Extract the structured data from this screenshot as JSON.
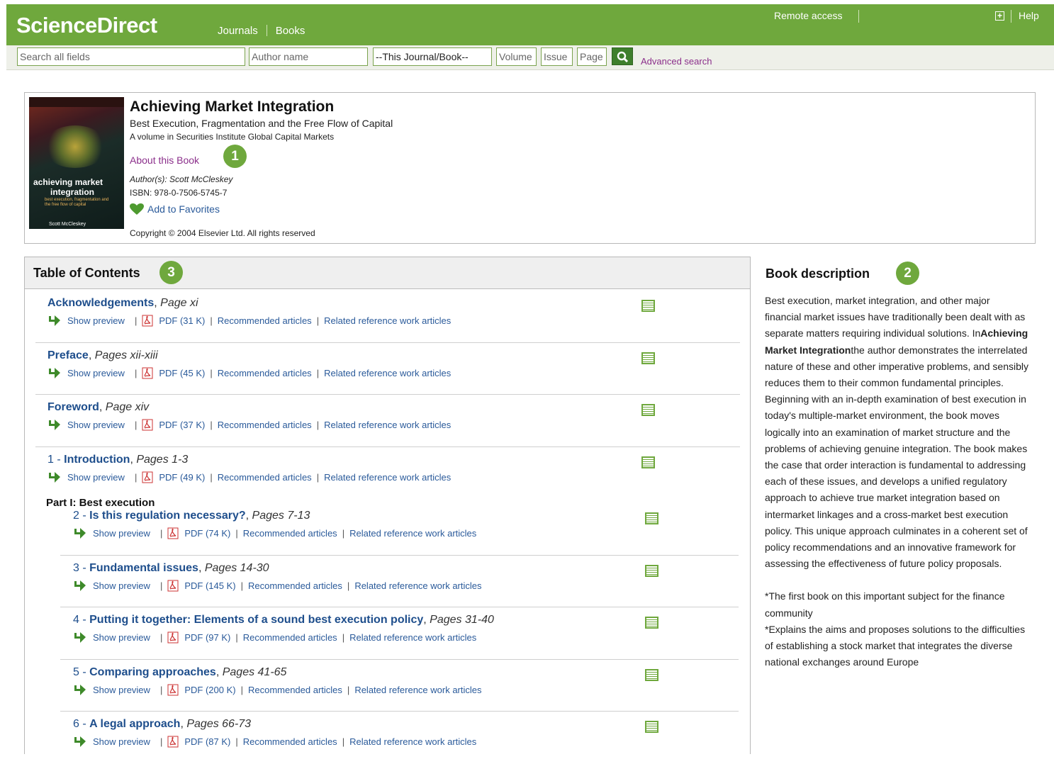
{
  "header": {
    "logo": "ScienceDirect",
    "nav": [
      "Journals",
      "Books"
    ],
    "remote_access": "Remote access",
    "help": "Help",
    "brand_color": "#6fa83d"
  },
  "search": {
    "all_fields_placeholder": "Search all fields",
    "author_placeholder": "Author name",
    "journal_select_value": "--This Journal/Book--",
    "volume_placeholder": "Volume",
    "issue_placeholder": "Issue",
    "page_placeholder": "Page",
    "advanced_label": "Advanced search"
  },
  "book": {
    "title": "Achieving Market Integration",
    "subtitle": "Best Execution, Fragmentation and the Free Flow of Capital",
    "volume": "A volume in Securities Institute Global Capital Markets",
    "about_link": "About this Book",
    "authors": "Author(s): Scott McCleskey",
    "isbn": "ISBN: 978-0-7506-5745-7",
    "favorites_label": "Add to Favorites",
    "copyright": "Copyright © 2004 Elsevier Ltd. All rights reserved",
    "cover": {
      "title_line1": "achieving market",
      "title_line2": "integration",
      "subtitle": "best execution, fragmentation and the free flow of capital",
      "author": "Scott McCleskey"
    }
  },
  "badges": [
    "1",
    "2",
    "3"
  ],
  "toc": {
    "heading": "Table of Contents",
    "part_label": "Part I: Best execution",
    "entries": [
      {
        "title": "Acknowledgements",
        "pages": "Page xi",
        "pdf": "PDF (31 K)"
      },
      {
        "title": "Preface",
        "pages": "Pages xii-xiii",
        "pdf": "PDF (45 K)"
      },
      {
        "title": "Foreword",
        "pages": "Page xiv",
        "pdf": "PDF (37 K)"
      },
      {
        "num": "1 - ",
        "title": "Introduction",
        "pages": "Pages 1-3",
        "pdf": "PDF (49 K)"
      },
      {
        "num": "2 - ",
        "title": "Is this regulation necessary?",
        "pages": "Pages 7-13",
        "pdf": "PDF (74 K)"
      },
      {
        "num": "3 - ",
        "title": "Fundamental issues",
        "pages": "Pages 14-30",
        "pdf": "PDF (145 K)"
      },
      {
        "num": "4 - ",
        "title": "Putting it together: Elements of a sound best execution policy",
        "pages": "Pages 31-40",
        "pdf": "PDF (97 K)"
      },
      {
        "num": "5 - ",
        "title": "Comparing approaches",
        "pages": "Pages 41-65",
        "pdf": "PDF (200 K)"
      },
      {
        "num": "6 - ",
        "title": "A legal approach",
        "pages": "Pages 66-73",
        "pdf": "PDF (87 K)"
      }
    ],
    "show_preview": "Show preview",
    "recommended": "Recommended articles",
    "related": "Related reference work articles"
  },
  "description": {
    "heading": "Book description",
    "p1_before": "Best execution, market integration, and other major financial market issues have traditionally been dealt with as separate matters requiring individual solutions. In",
    "p1_bold": "Achieving Market Integration",
    "p1_after": "the author demonstrates the interrelated nature of these and other imperative problems, and sensibly reduces them to their common fundamental principles. Beginning with an in-depth examination of best execution in today's multiple-market environment, the book moves logically into an examination of market structure and the problems of achieving genuine integration. The book makes the case that order interaction is fundamental to addressing each of these issues, and develops a unified regulatory approach to achieve true market integration based on intermarket linkages and a cross-market best execution policy. This unique approach culminates in a coherent set of policy recommendations and an innovative framework for assessing the effectiveness of future policy proposals.",
    "bullet1": "*The first book on this important subject for the finance community",
    "bullet2": "*Explains the aims and proposes solutions to the difficulties of establishing a stock market that integrates the diverse national exchanges around Europe"
  }
}
